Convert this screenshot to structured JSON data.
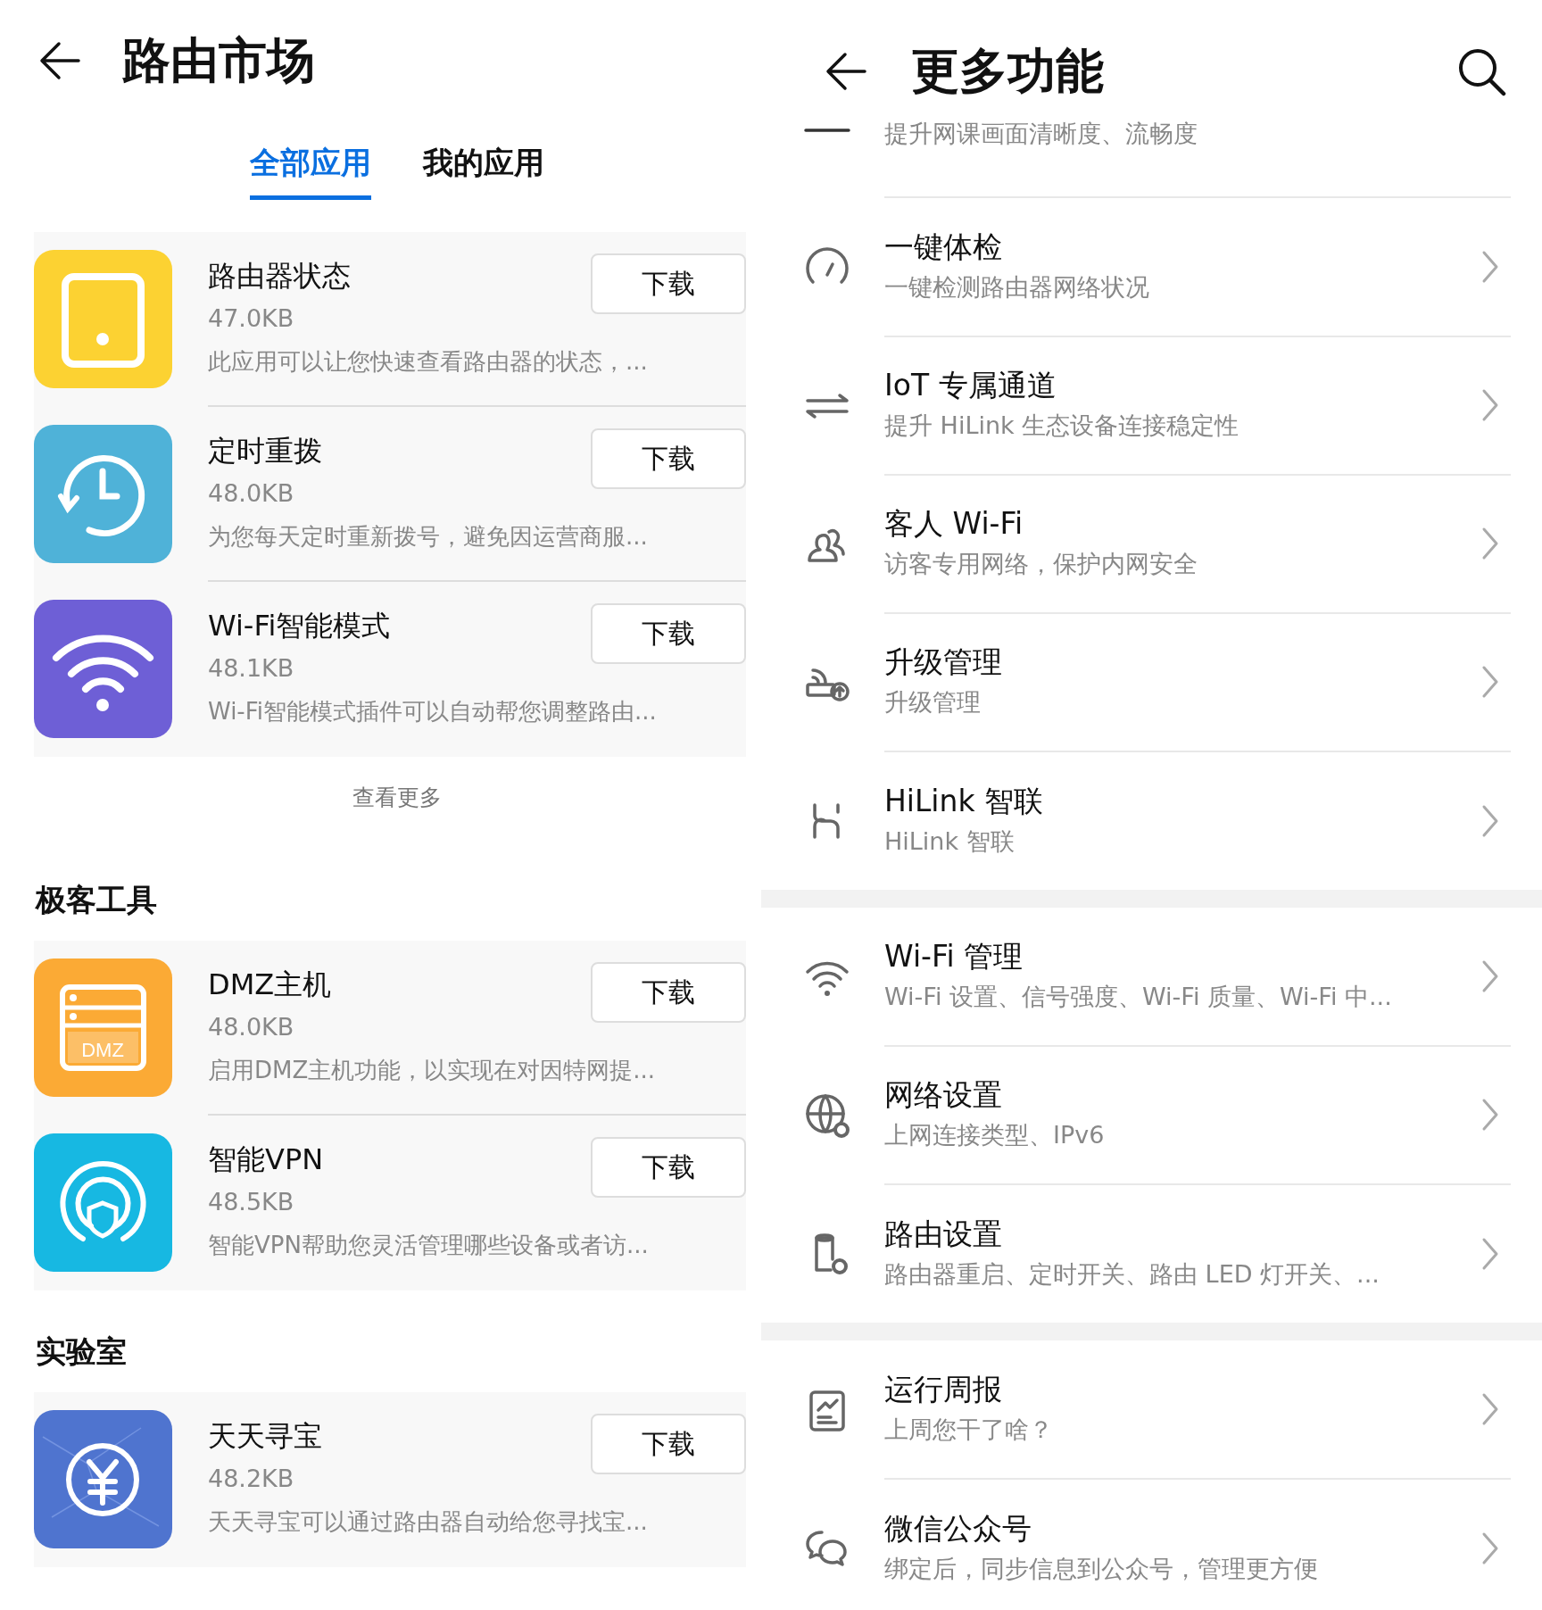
{
  "left_screen": {
    "title": "路由市场",
    "tabs": [
      {
        "label": "全部应用",
        "selected": true
      },
      {
        "label": "我的应用",
        "selected": false
      }
    ],
    "featured_apps": [
      {
        "name": "路由器状态",
        "size": "47.0KB",
        "description": "此应用可以让您快速查看路由器的状态，...",
        "button": "下载"
      },
      {
        "name": "定时重拨",
        "size": "48.0KB",
        "description": "为您每天定时重新拨号，避免因运营商服...",
        "button": "下载"
      },
      {
        "name": "Wi-Fi智能模式",
        "size": "48.1KB",
        "description": "Wi-Fi智能模式插件可以自动帮您调整路由...",
        "button": "下载"
      }
    ],
    "more_link": "查看更多",
    "sections": [
      {
        "title": "极客工具",
        "apps": [
          {
            "name": "DMZ主机",
            "icon_label": "DMZ",
            "size": "48.0KB",
            "description": "启用DMZ主机功能，以实现在对因特网提...",
            "button": "下载"
          },
          {
            "name": "智能VPN",
            "size": "48.5KB",
            "description": "智能VPN帮助您灵活管理哪些设备或者访...",
            "button": "下载"
          }
        ]
      },
      {
        "title": "实验室",
        "apps": [
          {
            "name": "天天寻宝",
            "size": "48.2KB",
            "description": "天天寻宝可以通过路由器自动给您寻找宝...",
            "button": "下载"
          }
        ]
      }
    ]
  },
  "right_screen": {
    "title": "更多功能",
    "clipped_item": {
      "subtitle": "提升网课画面清晰度、流畅度"
    },
    "groups": [
      [
        {
          "title": "一键体检",
          "subtitle": "一键检测路由器网络状况"
        },
        {
          "title": "IoT 专属通道",
          "subtitle": "提升 HiLink 生态设备连接稳定性"
        },
        {
          "title": "客人 Wi-Fi",
          "subtitle": "访客专用网络，保护内网安全"
        },
        {
          "title": "升级管理",
          "subtitle": "升级管理"
        },
        {
          "title": "HiLink 智联",
          "subtitle": "HiLink 智联"
        }
      ],
      [
        {
          "title": "Wi-Fi 管理",
          "subtitle": "Wi-Fi 设置、信号强度、Wi-Fi 质量、Wi-Fi 中..."
        },
        {
          "title": "网络设置",
          "subtitle": "上网连接类型、IPv6"
        },
        {
          "title": "路由设置",
          "subtitle": "路由器重启、定时开关、路由 LED 灯开关、..."
        }
      ],
      [
        {
          "title": "运行周报",
          "subtitle": "上周您干了啥？"
        },
        {
          "title": "微信公众号",
          "subtitle": "绑定后，同步信息到公众号，管理更方便"
        }
      ]
    ]
  }
}
